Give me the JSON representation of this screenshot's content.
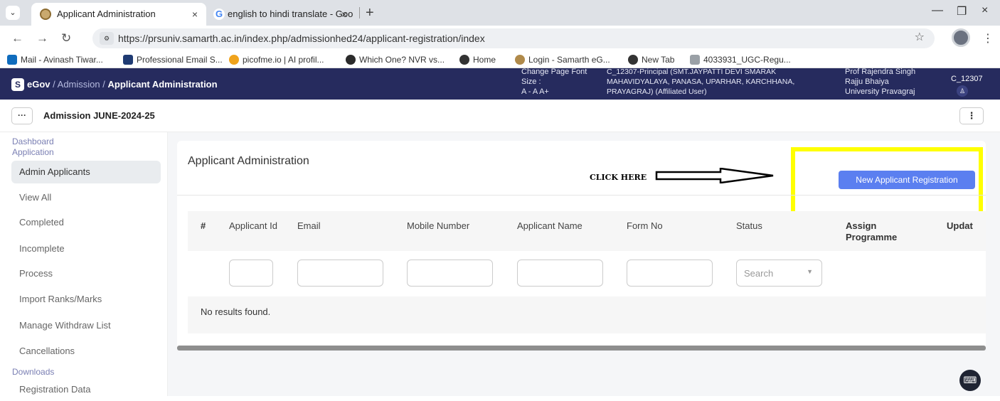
{
  "browser": {
    "tabs": [
      {
        "title": "Applicant Administration",
        "close": "×"
      },
      {
        "title": "english to hindi translate - Goo",
        "icon": "G",
        "close": "×"
      }
    ],
    "new_tab": "+",
    "window_controls": {
      "minimize": "—",
      "restore": "❐",
      "close": "×"
    },
    "url": "https://prsuniv.samarth.ac.in/index.php/admissionhed24/applicant-registration/index",
    "bookmarks": [
      {
        "label": "Mail - Avinash Tiwar...",
        "color": "#0f6cbd"
      },
      {
        "label": "Professional Email S...",
        "color": "#1f3b73"
      },
      {
        "label": "picofme.io | AI profil...",
        "color": "#f0a31c"
      },
      {
        "label": "Which One? NVR vs...",
        "color": "#2b2b2b"
      },
      {
        "label": "Home",
        "color": "#333333"
      },
      {
        "label": "Login - Samarth eG...",
        "color": "#b08a4a"
      },
      {
        "label": "New Tab",
        "color": "#333333"
      },
      {
        "label": "4033931_UGC-Regu...",
        "color": "#9aa0a6"
      }
    ]
  },
  "header": {
    "brand_badge": "S",
    "brand": "eGov",
    "crumb1": "Admission",
    "crumb2": "Applicant Administration",
    "font_size_label": "Change Page Font Size :",
    "font_controls": "A - A A+",
    "user_role": "C_12307-Principal (SMT.JAYPATTI DEVI SMARAK MAHAVIDYALAYA, PANASA, UPARHAR, KARCHHANA, PRAYAGRAJ) (Affiliated User)",
    "officer": "Prof Rajendra Singh Rajju Bhaiya University Pravagraj",
    "user_id": "C_12307"
  },
  "subheader": {
    "session": "Admission JUNE-2024-25"
  },
  "sidebar": {
    "headings": [
      "Dashboard",
      "Application",
      "Downloads"
    ],
    "items": [
      "Admin Applicants",
      "View All",
      "Completed",
      "Incomplete",
      "Process",
      "Import Ranks/Marks",
      "Manage Withdraw List",
      "Cancellations"
    ],
    "download_items": [
      "Registration Data"
    ]
  },
  "main": {
    "title": "Applicant Administration",
    "annotation": "CLICK HERE",
    "new_button": "New Applicant Registration",
    "table": {
      "columns": [
        "#",
        "Applicant Id",
        "Email",
        "Mobile Number",
        "Applicant Name",
        "Form No",
        "Status",
        "Assign Programme",
        "Updat"
      ],
      "status_placeholder": "Search",
      "empty_text": "No results found."
    }
  },
  "colors": {
    "accent": "#5b7ff0",
    "header_bg": "#262b5e",
    "highlight": "#ffff00"
  }
}
